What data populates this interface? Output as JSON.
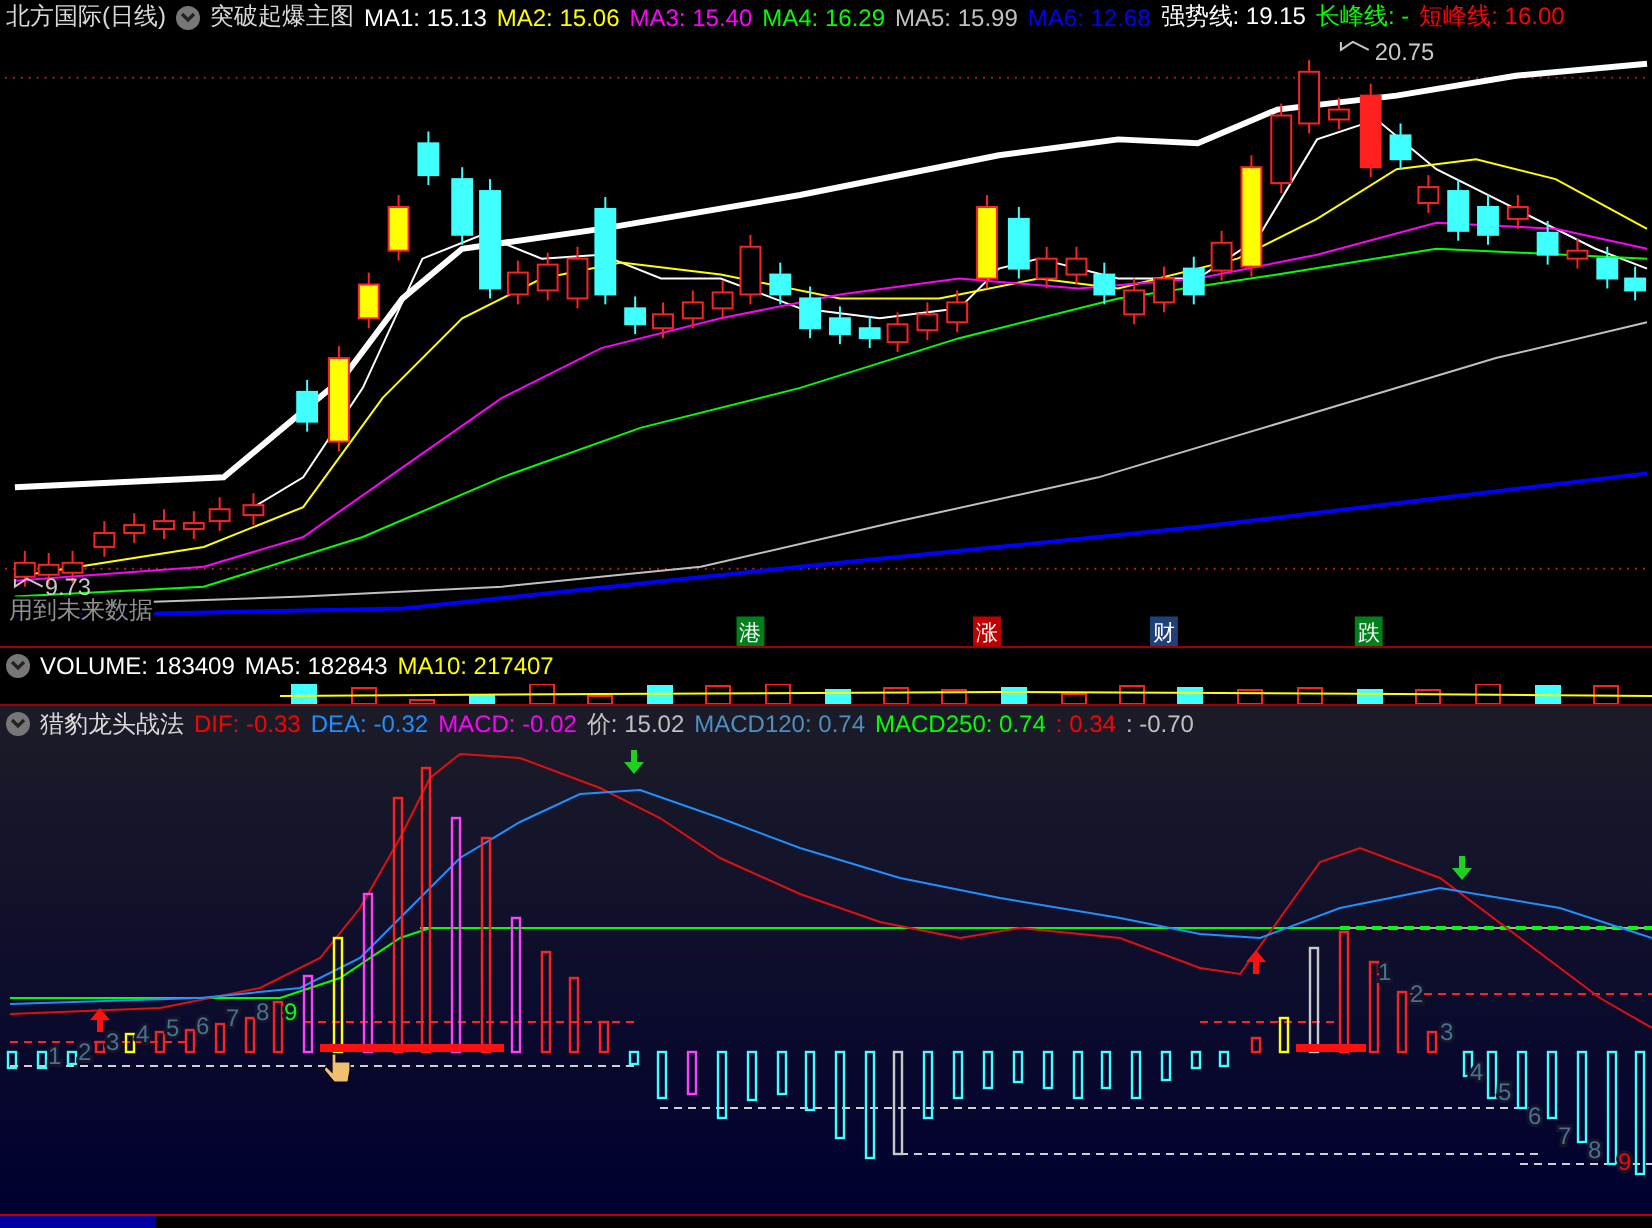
{
  "main_chart": {
    "symbol": "北方国际(日线)",
    "indicator": "突破起爆主图",
    "legend": [
      {
        "text": "MA1: 15.13",
        "color": "#ffffff"
      },
      {
        "text": "MA2: 15.06",
        "color": "#ffff00"
      },
      {
        "text": "MA3: 15.40",
        "color": "#ff00ff"
      },
      {
        "text": "MA4: 16.29",
        "color": "#00ff00"
      },
      {
        "text": "MA5: 15.99",
        "color": "#c0c0c0"
      },
      {
        "text": "MA6: 12.68",
        "color": "#0000ff"
      },
      {
        "text": "强势线: 19.15",
        "color": "#ffffff"
      },
      {
        "text": "长峰线: -",
        "color": "#00ff00"
      },
      {
        "text": "短峰线: 16.00",
        "color": "#ff0000"
      }
    ],
    "high_label": "20.75",
    "low_label": "9.73",
    "warning": "用到未来数据",
    "event_markers": [
      {
        "text": "港",
        "color": "#00801a"
      },
      {
        "text": "涨",
        "color": "#c00000"
      },
      {
        "text": "财",
        "color": "#20407a"
      },
      {
        "text": "跌",
        "color": "#00801a"
      }
    ]
  },
  "volume_panel": {
    "legend": [
      {
        "text": "VOLUME: 183409",
        "color": "#ffffff"
      },
      {
        "text": "MA5: 182843",
        "color": "#ffffff"
      },
      {
        "text": "MA10: 217407",
        "color": "#ffff00"
      }
    ]
  },
  "macd_panel": {
    "title": "猎豹龙头战法",
    "legend": [
      {
        "text": "DIF: -0.33",
        "color": "#ff0000"
      },
      {
        "text": "DEA: -0.32",
        "color": "#1e90ff"
      },
      {
        "text": "MACD: -0.02",
        "color": "#ff00ff"
      },
      {
        "text": "价: 15.02",
        "color": "#c0c0c0"
      },
      {
        "text": "MACD120: 0.74",
        "color": "#4f8fc0"
      },
      {
        "text": "MACD250: 0.74",
        "color": "#00ff00"
      },
      {
        "text": ": 0.34",
        "color": "#ff0000"
      },
      {
        "text": ": -0.70",
        "color": "#c0c0c0"
      }
    ],
    "count_labels": [
      {
        "text": "1",
        "color": "#4a7090"
      },
      {
        "text": "2",
        "color": "#4a7090"
      },
      {
        "text": "3",
        "color": "#4a7090"
      },
      {
        "text": "4",
        "color": "#4a7090"
      },
      {
        "text": "5",
        "color": "#4a7090"
      },
      {
        "text": "6",
        "color": "#4a7090"
      },
      {
        "text": "7",
        "color": "#4a7090"
      },
      {
        "text": "8",
        "color": "#4a7090"
      },
      {
        "text": "9",
        "color": "#00ff00"
      },
      {
        "text": "1",
        "color": "#4a7090"
      },
      {
        "text": "2",
        "color": "#4a7090"
      },
      {
        "text": "3",
        "color": "#4a7090"
      },
      {
        "text": "4",
        "color": "#4a7090"
      },
      {
        "text": "5",
        "color": "#4a7090"
      },
      {
        "text": "6",
        "color": "#4a7090"
      },
      {
        "text": "7",
        "color": "#4a7090"
      },
      {
        "text": "8",
        "color": "#4a7090"
      },
      {
        "text": "9",
        "color": "#ff0000"
      }
    ]
  }
}
